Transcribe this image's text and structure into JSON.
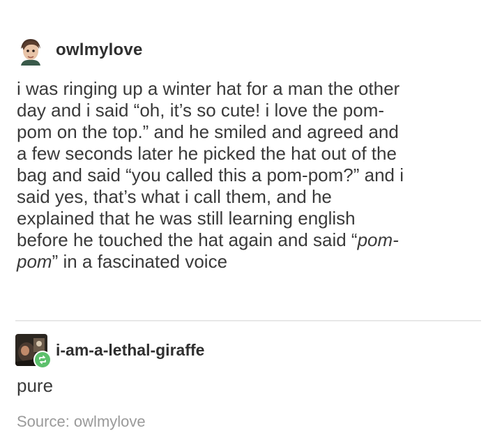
{
  "post": {
    "author": "owlmylove",
    "body_lines": [
      "i was ringing up a winter hat for a man the other",
      "day and i said “oh, it’s so cute! i love the pom-",
      "pom on the top.” and he smiled and agreed and",
      "a few seconds later he picked the hat out of the",
      "bag and said “you called this a pom-pom?” and i",
      "said yes, that’s what i call them, and he",
      "explained that he was still learning english",
      "before he touched the hat again and said “",
      "” in a fascinated voice"
    ],
    "italic_1": "pom-",
    "italic_2": "pom"
  },
  "reblog": {
    "author": "i-am-a-lethal-giraffe",
    "text": "pure",
    "icon": "reblog-icon",
    "badge_color": "#5cc06c"
  },
  "source": {
    "label": "Source: owlmylove"
  }
}
